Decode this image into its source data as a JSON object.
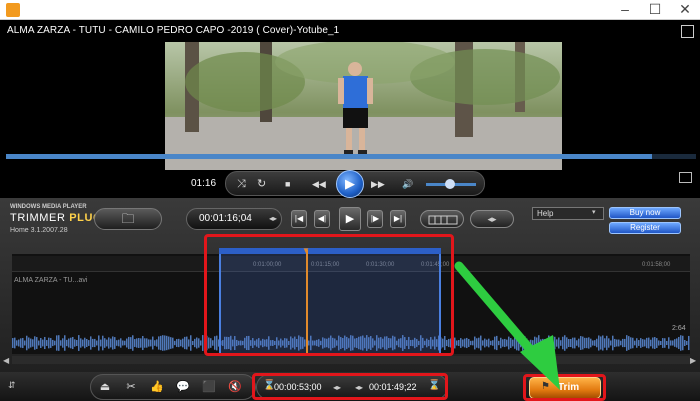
{
  "window": {
    "minimize": "–",
    "maximize": "☐",
    "close": "✕"
  },
  "video": {
    "title": "ALMA ZARZA - TUTU - CAMILO PEDRO CAPO -2019 ( Cover)-Yotube_1",
    "progress": 0.93
  },
  "player": {
    "time": "01:16",
    "buttons": {
      "shuffle": "⤨",
      "repeat": "↻",
      "stop": "■",
      "prev": "◀◀",
      "play": "▶",
      "next": "▶▶",
      "volume": "🔊"
    },
    "volume_level": 0.45
  },
  "trimmer": {
    "brand": "WINDOWS MEDIA PLAYER",
    "title_prefix": "TRIMMER",
    "title_bold": "PLUGIN",
    "version": "Home 3.1.2007.28",
    "folder_icon": "🗀",
    "current_time": "00:01:16;04",
    "time_arrows": "◂▸",
    "transport": {
      "first": "|◀",
      "step_back": "◀|",
      "play": "▶",
      "step_fwd": "|▶",
      "last": "▶|"
    },
    "waveform_toggle": "◂▸",
    "help_select": "Help",
    "buy_now": "Buy now",
    "register": "Register"
  },
  "timeline": {
    "ruler_ticks": [
      "0:01:00;00",
      "0:01:15;00",
      "0:01:30;00",
      "0:01:45;00",
      "0:01:58;00"
    ],
    "clip_label": "ALMA ZARZA - TU...avi",
    "level_value": "2:64",
    "selection_start_pct": 0.305,
    "selection_end_pct": 0.635,
    "playhead_pct": 0.435
  },
  "bottom": {
    "expand": "⇵",
    "tools": [
      "⏏",
      "✂",
      "👍",
      "💬",
      "⬛",
      "🔇"
    ],
    "start_time": "00:00:53;00",
    "end_time": "00:01:49;22",
    "arrows": "◂▸",
    "start_icon": "⌛",
    "end_icon": "⌛",
    "trim_label": "Trim",
    "trim_icon": "⚑"
  },
  "colors": {
    "accent": "#4a86c8",
    "annotation": "#e2161b",
    "arrow": "#2ecc40",
    "trim": "#e27a10"
  }
}
